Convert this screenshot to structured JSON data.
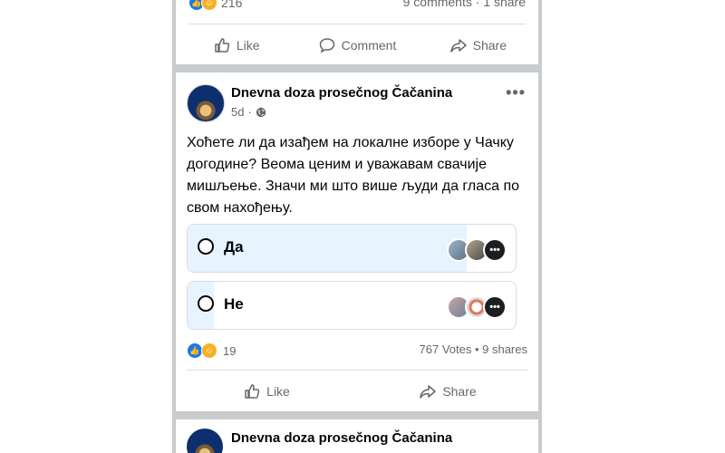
{
  "top_post": {
    "reaction_count": "216",
    "comments_shares": "9 comments · 1 share",
    "actions": {
      "like": "Like",
      "comment": "Comment",
      "share": "Share"
    }
  },
  "post": {
    "page_name": "Dnevna doza prosečnog Čačanina",
    "time": "5d",
    "text": "Хоћете ли да изађем на локалне изборе у Чачку догодине? Веома ценим и уважавам свачије мишљење. Значи ми што више људи да гласа по свом нахођењу.",
    "poll": {
      "options": [
        {
          "label": "Да",
          "fill_percent": 85
        },
        {
          "label": "Не",
          "fill_percent": 8
        }
      ]
    },
    "reaction_count": "19",
    "votes_shares": "767 Votes • 9 shares",
    "actions": {
      "like": "Like",
      "share": "Share"
    }
  },
  "next_post": {
    "page_name": "Dnevna doza prosečnog Čačanina"
  },
  "icons": {
    "like": "thumbs-up-icon",
    "comment": "comment-bubble-icon",
    "share": "share-arrow-icon",
    "privacy": "globe-icon",
    "more": "more-dots-icon"
  },
  "colors": {
    "accent": "#1877f2",
    "poll_fill": "#e7f3ff",
    "secondary_text": "#65676b"
  }
}
